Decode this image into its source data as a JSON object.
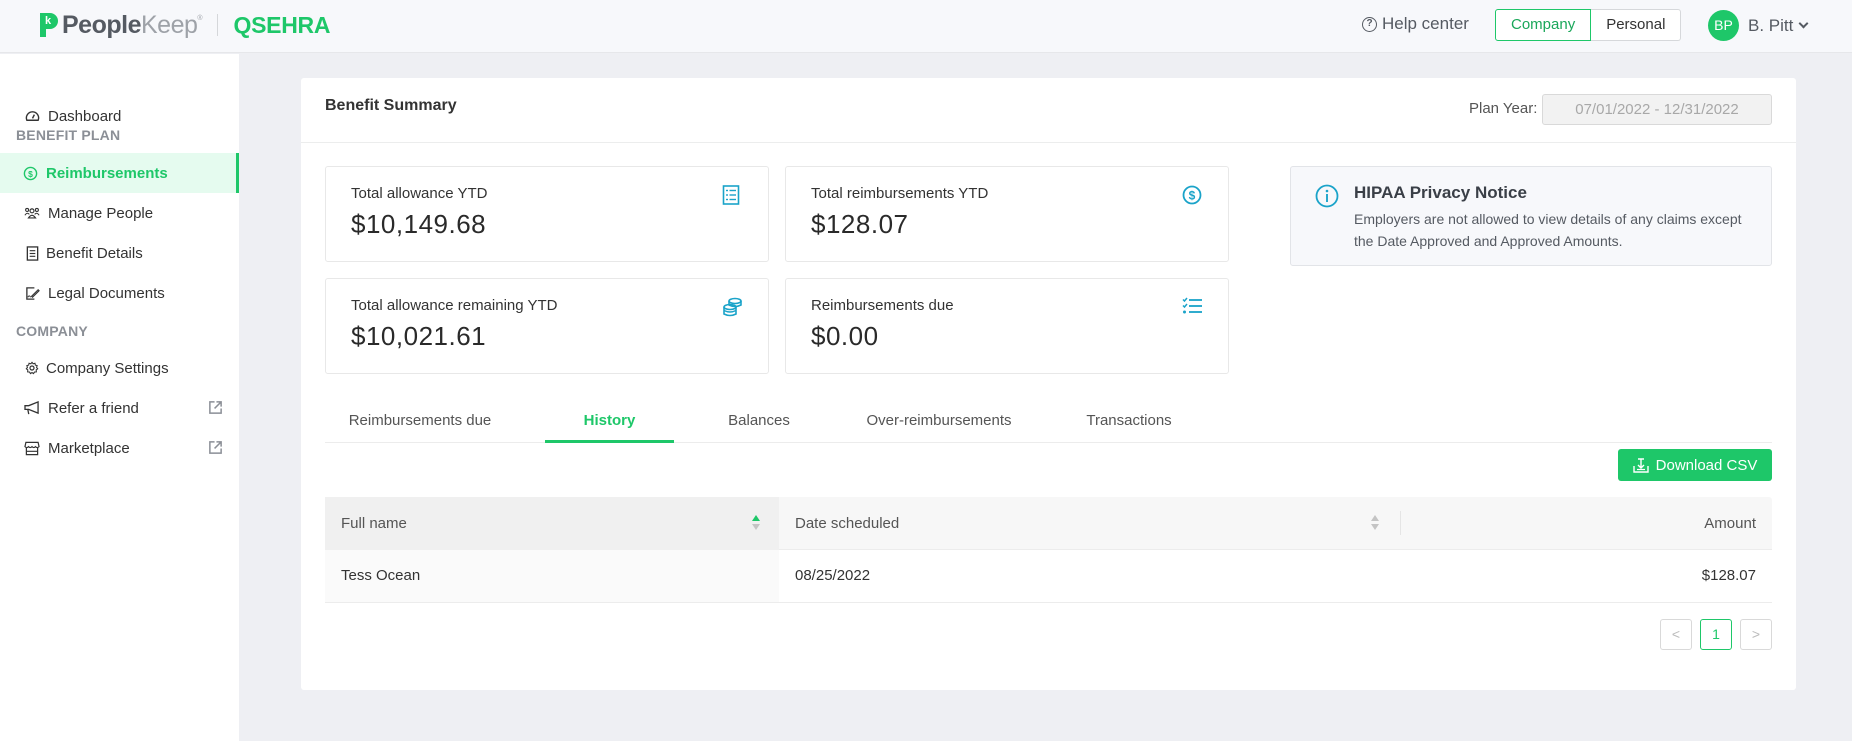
{
  "brand": {
    "logo_mark": "k",
    "name_part1": "People",
    "name_part2": "Keep",
    "registered": "®",
    "product": "QSEHRA"
  },
  "header": {
    "help_label": "Help center",
    "help_icon": "question-circle-icon",
    "modes": [
      "Company",
      "Personal"
    ],
    "active_mode": "Company",
    "user_initials": "BP",
    "user_name": "B. Pitt"
  },
  "sidebar": {
    "items": [
      {
        "label": "Dashboard",
        "icon": "dashboard-gauge-icon"
      },
      {
        "section": "BENEFIT PLAN"
      },
      {
        "label": "Reimbursements",
        "icon": "dollar-circle-icon",
        "active": true
      },
      {
        "label": "Manage People",
        "icon": "people-group-icon"
      },
      {
        "label": "Benefit Details",
        "icon": "checklist-document-icon"
      },
      {
        "label": "Legal Documents",
        "icon": "signed-document-icon"
      },
      {
        "section": "COMPANY"
      },
      {
        "label": "Company Settings",
        "icon": "gear-icon"
      },
      {
        "label": "Refer a friend",
        "icon": "megaphone-icon",
        "external": true
      },
      {
        "label": "Marketplace",
        "icon": "store-icon",
        "external": true
      }
    ]
  },
  "summary": {
    "title": "Benefit Summary",
    "plan_year_label": "Plan Year:",
    "plan_year_value": "07/01/2022 - 12/31/2022",
    "stats": [
      {
        "label": "Total allowance YTD",
        "value": "$10,149.68",
        "icon": "checklist-document-icon"
      },
      {
        "label": "Total reimbursements YTD",
        "value": "$128.07",
        "icon": "dollar-circle-icon"
      },
      {
        "label": "Total allowance remaining YTD",
        "value": "$10,021.61",
        "icon": "coins-stack-icon"
      },
      {
        "label": "Reimbursements due",
        "value": "$0.00",
        "icon": "task-list-icon"
      }
    ],
    "notice": {
      "title": "HIPAA Privacy Notice",
      "text": "Employers are not allowed to view details of any claims except the Date Approved and Approved Amounts.",
      "icon": "info-circle-icon"
    },
    "accent_color": "#1ec769",
    "icon_color": "#1aa3c9"
  },
  "tabs": [
    {
      "label": "Reimbursements due"
    },
    {
      "label": "History",
      "active": true
    },
    {
      "label": "Balances"
    },
    {
      "label": "Over-reimbursements"
    },
    {
      "label": "Transactions"
    }
  ],
  "history": {
    "download_label": "Download CSV",
    "columns": [
      "Full name",
      "Date scheduled",
      "Amount"
    ],
    "sort": {
      "column": "Full name",
      "direction": "ascending"
    },
    "rows": [
      {
        "full_name": "Tess Ocean",
        "date_scheduled": "08/25/2022",
        "amount": "$128.07"
      }
    ],
    "pagination": {
      "prev": "<",
      "current": "1",
      "next": ">"
    }
  }
}
